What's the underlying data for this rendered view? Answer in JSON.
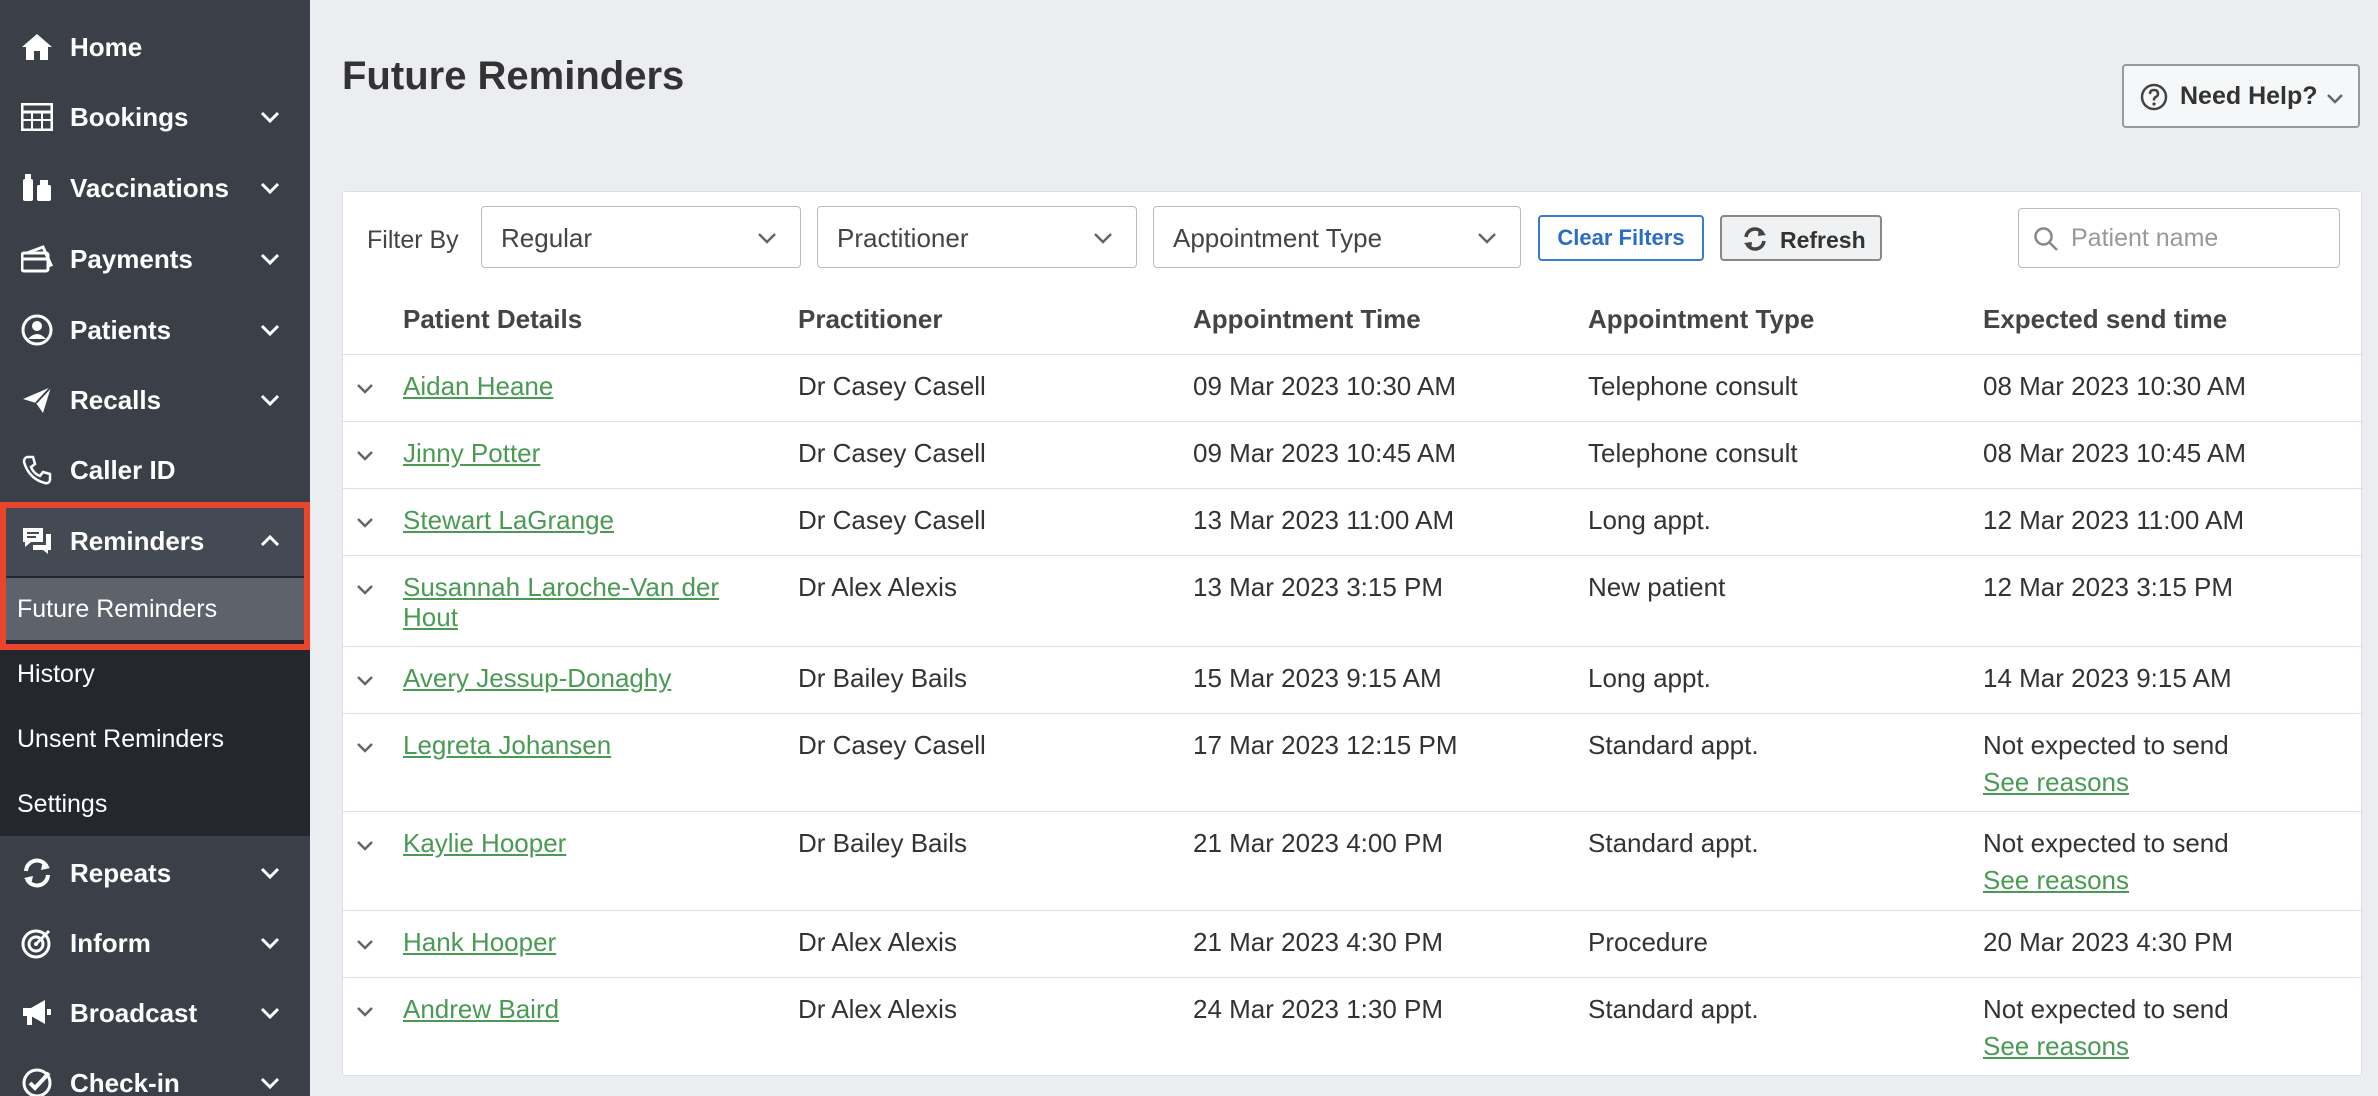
{
  "sidebar": {
    "items": [
      {
        "label": "Home",
        "icon": "home-icon"
      },
      {
        "label": "Bookings",
        "icon": "calendar-grid-icon"
      },
      {
        "label": "Vaccinations",
        "icon": "vial-icon"
      },
      {
        "label": "Payments",
        "icon": "credit-card-icon"
      },
      {
        "label": "Patients",
        "icon": "user-circle-icon"
      },
      {
        "label": "Recalls",
        "icon": "paper-plane-icon"
      },
      {
        "label": "Caller ID",
        "icon": "phone-icon"
      },
      {
        "label": "Reminders",
        "icon": "chat-bubbles-icon"
      },
      {
        "label": "Repeats",
        "icon": "repeat-icon"
      },
      {
        "label": "Inform",
        "icon": "target-icon"
      },
      {
        "label": "Broadcast",
        "icon": "megaphone-icon"
      },
      {
        "label": "Check-in",
        "icon": "check-circle-icon"
      }
    ],
    "reminders_sub": [
      "Future Reminders",
      "History",
      "Unsent Reminders",
      "Settings"
    ]
  },
  "header": {
    "title": "Future Reminders",
    "help_label": "Need Help?"
  },
  "filters": {
    "label": "Filter By",
    "reminder_type": "Regular",
    "practitioner": "Practitioner",
    "appointment_type": "Appointment Type",
    "clear_label": "Clear Filters",
    "refresh_label": "Refresh",
    "search_placeholder": "Patient name"
  },
  "table": {
    "columns": [
      "Patient Details",
      "Practitioner",
      "Appointment Time",
      "Appointment Type",
      "Expected send time"
    ],
    "rows": [
      {
        "patient": "Aidan Heane",
        "practitioner": "Dr Casey Casell",
        "time": "09 Mar 2023 10:30 AM",
        "type": "Telephone consult",
        "send": "08 Mar 2023 10:30 AM",
        "reasons": ""
      },
      {
        "patient": "Jinny Potter",
        "practitioner": "Dr Casey Casell",
        "time": "09 Mar 2023 10:45 AM",
        "type": "Telephone consult",
        "send": "08 Mar 2023 10:45 AM",
        "reasons": ""
      },
      {
        "patient": "Stewart LaGrange",
        "practitioner": "Dr Casey Casell",
        "time": "13 Mar 2023 11:00 AM",
        "type": "Long appt.",
        "send": "12 Mar 2023 11:00 AM",
        "reasons": ""
      },
      {
        "patient_line1": "Susannah Laroche-Van der",
        "patient_line2": "Hout",
        "practitioner": "Dr Alex Alexis",
        "time": "13 Mar 2023 3:15 PM",
        "type": "New patient",
        "send": "12 Mar 2023 3:15 PM",
        "reasons": ""
      },
      {
        "patient": "Avery Jessup-Donaghy",
        "practitioner": "Dr Bailey Bails",
        "time": "15 Mar 2023 9:15 AM",
        "type": "Long appt.",
        "send": "14 Mar 2023 9:15 AM",
        "reasons": ""
      },
      {
        "patient": "Legreta Johansen",
        "practitioner": "Dr Casey Casell",
        "time": "17 Mar 2023 12:15 PM",
        "type": "Standard appt.",
        "send": "Not expected to send",
        "reasons": "See reasons"
      },
      {
        "patient": "Kaylie Hooper",
        "practitioner": "Dr Bailey Bails",
        "time": "21 Mar 2023 4:00 PM",
        "type": "Standard appt.",
        "send": "Not expected to send",
        "reasons": "See reasons"
      },
      {
        "patient": "Hank Hooper",
        "practitioner": "Dr Alex Alexis",
        "time": "21 Mar 2023 4:30 PM",
        "type": "Procedure",
        "send": "20 Mar 2023 4:30 PM",
        "reasons": ""
      },
      {
        "patient": "Andrew Baird",
        "practitioner": "Dr Alex Alexis",
        "time": "24 Mar 2023 1:30 PM",
        "type": "Standard appt.",
        "send": "Not expected to send",
        "reasons": "See reasons"
      }
    ]
  },
  "colors": {
    "sidebar_bg": "#3a3f48",
    "submenu_bg": "#24282e",
    "highlight": "#e8452c",
    "link_green": "#4a9a54",
    "clear_blue": "#2b6cc4"
  }
}
